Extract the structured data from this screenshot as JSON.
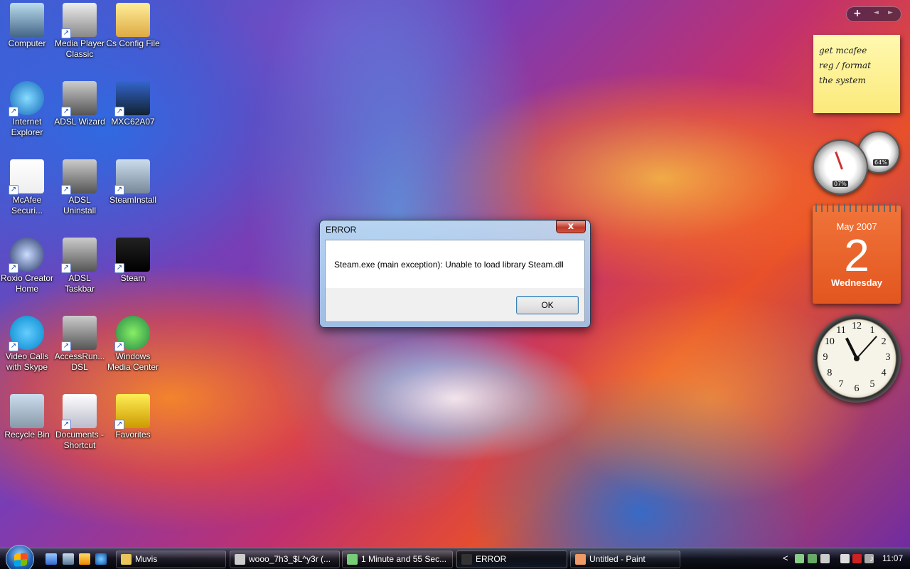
{
  "desktop": {
    "icons": [
      {
        "label": "Computer",
        "icon": "computer-icon"
      },
      {
        "label": "Media Player Classic",
        "icon": "media-player-icon"
      },
      {
        "label": "Cs Config File",
        "icon": "folder-icon"
      },
      {
        "label": "Internet Explorer",
        "icon": "internet-explorer-icon"
      },
      {
        "label": "ADSL Wizard",
        "icon": "adsl-wizard-icon"
      },
      {
        "label": "MXC62A07",
        "icon": "mxc-tool-icon"
      },
      {
        "label": "McAfee Securi...",
        "icon": "mcafee-icon"
      },
      {
        "label": "ADSL Uninstall",
        "icon": "adsl-uninstall-icon"
      },
      {
        "label": "SteamInstall",
        "icon": "steam-install-icon"
      },
      {
        "label": "Roxio Creator Home",
        "icon": "roxio-icon"
      },
      {
        "label": "ADSL Taskbar",
        "icon": "adsl-taskbar-icon"
      },
      {
        "label": "Steam",
        "icon": "steam-icon"
      },
      {
        "label": "Video Calls with Skype",
        "icon": "skype-icon"
      },
      {
        "label": "AccessRun... DSL",
        "icon": "accessrunner-icon"
      },
      {
        "label": "Windows Media Center",
        "icon": "media-center-icon"
      },
      {
        "label": "Recycle Bin",
        "icon": "recycle-bin-icon"
      },
      {
        "label": "Documents - Shortcut",
        "icon": "documents-icon"
      },
      {
        "label": "Favorites",
        "icon": "favorites-icon"
      }
    ]
  },
  "dialog": {
    "title": "ERROR",
    "close_label": "x",
    "message": "Steam.exe (main exception): Unable to load library Steam.dll",
    "ok_label": "OK"
  },
  "sidebar": {
    "add_label": "+",
    "prev_label": "◄",
    "next_label": "►",
    "note": {
      "lines": [
        "get mcafee",
        "reg / format",
        "the system"
      ]
    },
    "meter": {
      "cpu": "07%",
      "memory": "64%"
    },
    "calendar": {
      "month_year": "May 2007",
      "day": "2",
      "weekday": "Wednesday"
    },
    "clock": {
      "numbers": [
        "12",
        "1",
        "2",
        "3",
        "4",
        "5",
        "6",
        "7",
        "8",
        "9",
        "10",
        "11"
      ],
      "hour": 11,
      "minute": 7
    }
  },
  "taskbar": {
    "buttons": [
      {
        "label": "Muvis",
        "icon": "folder-icon"
      },
      {
        "label": "wooo_7h3_$L^y3r (...",
        "icon": "drive-icon"
      },
      {
        "label": "1 Minute and 55 Sec...",
        "icon": "chat-icon"
      },
      {
        "label": "ERROR",
        "icon": "steam-icon"
      },
      {
        "label": "Untitled - Paint",
        "icon": "paint-icon"
      }
    ],
    "tray": {
      "chevron": "<",
      "time": "11:07"
    }
  },
  "colors": {
    "calendar": "#e2561f",
    "note": "#fbe97a",
    "dialog_close": "#c0392b"
  }
}
